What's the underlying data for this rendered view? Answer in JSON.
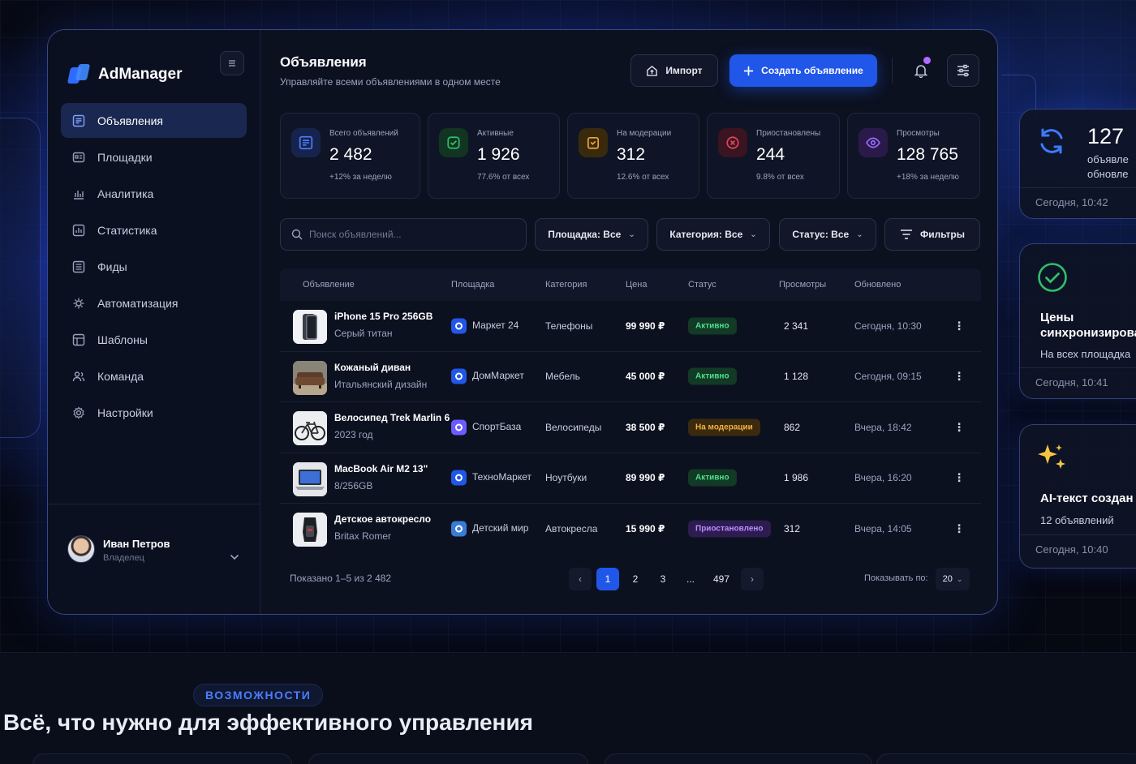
{
  "app": {
    "name": "AdManager"
  },
  "sidebar": {
    "items": [
      {
        "label": "Объявления",
        "icon": "ads-icon",
        "active": true
      },
      {
        "label": "Площадки",
        "icon": "platforms-icon"
      },
      {
        "label": "Аналитика",
        "icon": "analytics-icon"
      },
      {
        "label": "Статистика",
        "icon": "statistics-icon"
      },
      {
        "label": "Фиды",
        "icon": "feeds-icon"
      },
      {
        "label": "Автоматизация",
        "icon": "automation-icon"
      },
      {
        "label": "Шаблоны",
        "icon": "templates-icon"
      },
      {
        "label": "Команда",
        "icon": "team-icon"
      },
      {
        "label": "Настройки",
        "icon": "settings-icon"
      }
    ],
    "user": {
      "name": "Иван Петров",
      "role": "Владелец"
    }
  },
  "header": {
    "title": "Объявления",
    "subtitle": "Управляйте всеми объявлениями в одном месте",
    "import_label": "Импорт",
    "create_label": "Создать объявление"
  },
  "stats": [
    {
      "label": "Всего объявлений",
      "value": "2 482",
      "note": "+12% за неделю",
      "color": "#3d6dff"
    },
    {
      "label": "Активные",
      "value": "1 926",
      "note": "77.6% от всех",
      "color": "#2fbf6a"
    },
    {
      "label": "На модерации",
      "value": "312",
      "note": "12.6% от всех",
      "color": "#f0a63a"
    },
    {
      "label": "Приостановлены",
      "value": "244",
      "note": "9.8% от всех",
      "color": "#e0445b"
    },
    {
      "label": "Просмотры",
      "value": "128 765",
      "note": "+18% за неделю",
      "color": "#9b6bff"
    }
  ],
  "filters": {
    "search_placeholder": "Поиск объявлений...",
    "platform": "Площадка: Все",
    "category": "Категория: Все",
    "status": "Статус: Все",
    "more": "Фильтры"
  },
  "table": {
    "columns": [
      "Объявление",
      "Площадка",
      "Категория",
      "Цена",
      "Статус",
      "Просмотры",
      "Обновлено"
    ],
    "rows": [
      {
        "title": "iPhone 15 Pro 256GB",
        "subtitle": "Серый титан",
        "platform": "Маркет 24",
        "category": "Телефоны",
        "price": "99 990 ₽",
        "status": "Активно",
        "status_kind": "green",
        "views": "2 341",
        "updated": "Сегодня, 10:30",
        "thumb": "phone"
      },
      {
        "title": "Кожаный диван",
        "subtitle": "Итальянский дизайн",
        "platform": "ДомМаркет",
        "category": "Мебель",
        "price": "45 000 ₽",
        "status": "Активно",
        "status_kind": "green",
        "views": "1 128",
        "updated": "Сегодня, 09:15",
        "thumb": "sofa"
      },
      {
        "title": "Велосипед Trek Marlin 6",
        "subtitle": "2023 год",
        "platform": "СпортБаза",
        "category": "Велосипеды",
        "price": "38 500 ₽",
        "status": "На модерации",
        "status_kind": "amber",
        "views": "862",
        "updated": "Вчера, 18:42",
        "thumb": "bike"
      },
      {
        "title": "MacBook Air M2 13\"",
        "subtitle": "8/256GB",
        "platform": "ТехноМаркет",
        "category": "Ноутбуки",
        "price": "89 990 ₽",
        "status": "Активно",
        "status_kind": "green",
        "views": "1 986",
        "updated": "Вчера, 16:20",
        "thumb": "laptop"
      },
      {
        "title": "Детское автокресло",
        "subtitle": "Britax Romer",
        "platform": "Детский мир",
        "category": "Автокресла",
        "price": "15 990 ₽",
        "status": "Приостановлено",
        "status_kind": "violet",
        "views": "312",
        "updated": "Вчера, 14:05",
        "thumb": "carseat"
      }
    ]
  },
  "pagination": {
    "info": "Показано 1–5 из 2 482",
    "pages": [
      "1",
      "2",
      "3",
      "...",
      "497"
    ],
    "current": "1",
    "per_page_label": "Показывать по:",
    "per_page": "20"
  },
  "toasts": [
    {
      "big": "127",
      "line1": "объявле",
      "line2": "обновле",
      "time": "Сегодня, 10:42"
    },
    {
      "title1": "Цены",
      "title2": "синхронизирова",
      "text": "На всех площадка",
      "time": "Сегодня, 10:41"
    },
    {
      "title1": "AI-текст создан",
      "text": "12 объявлений",
      "time": "Сегодня, 10:40"
    }
  ],
  "section": {
    "tag": "ВОЗМОЖНОСТИ",
    "headline": "Всё, что нужно для эффективного управления"
  }
}
